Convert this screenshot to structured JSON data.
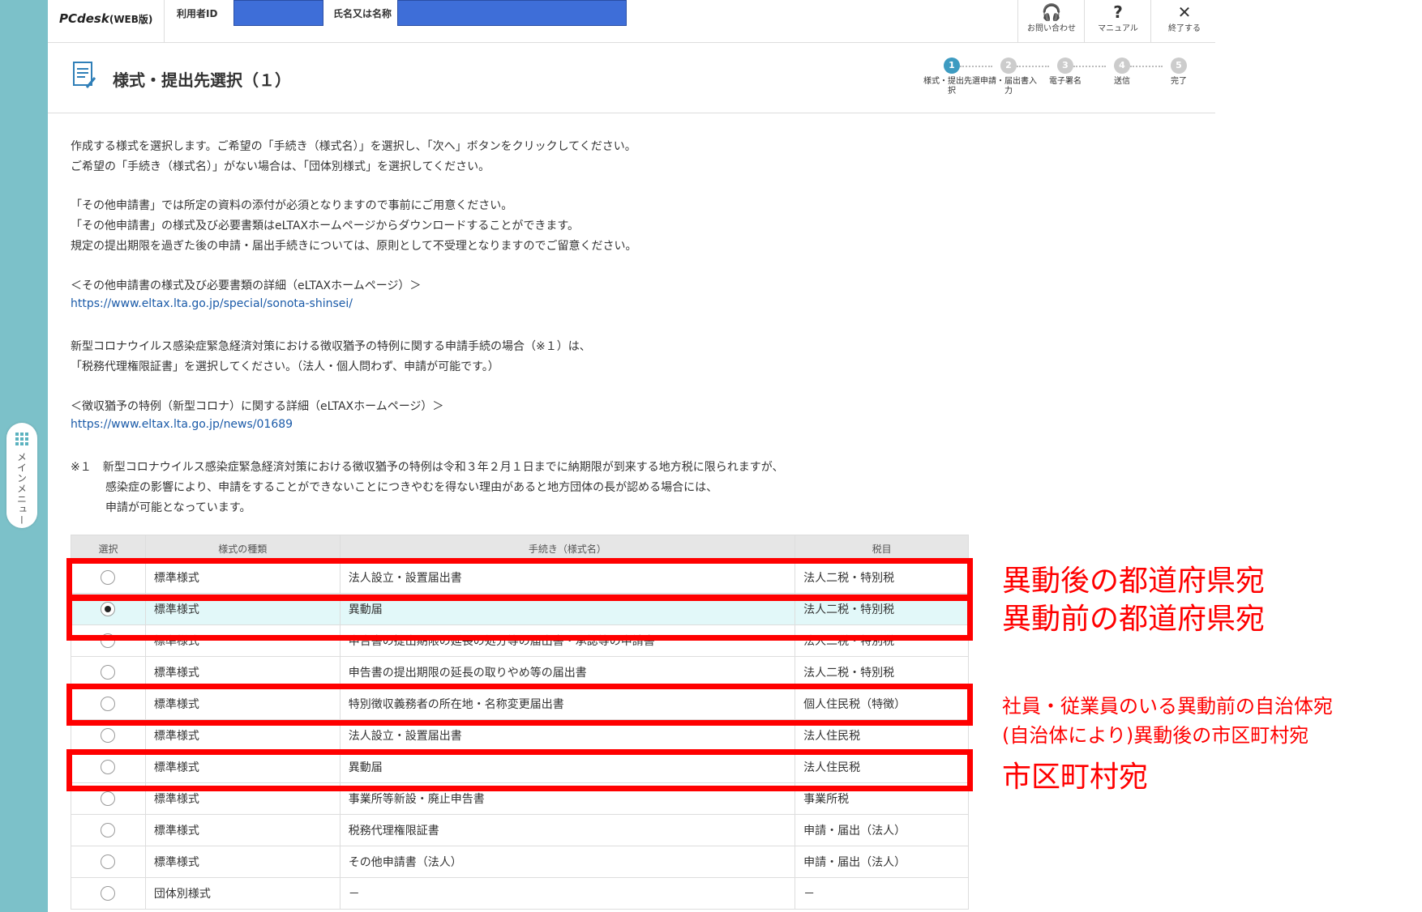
{
  "header": {
    "logo_main": "PCdesk",
    "logo_sub": "(WEB版)",
    "user_id_label": "利用者ID",
    "name_label": "氏名又は名称",
    "buttons": [
      {
        "icon": "headset-icon",
        "glyph": "🎧",
        "label": "お問い合わせ"
      },
      {
        "icon": "help-icon",
        "glyph": "?",
        "label": "マニュアル"
      },
      {
        "icon": "close-icon",
        "glyph": "✕",
        "label": "終了する"
      }
    ]
  },
  "side_menu": {
    "label": "メインメニュー"
  },
  "title": "様式・提出先選択（１）",
  "steps": [
    {
      "num": "1",
      "label": "様式・提出先選択",
      "active": true
    },
    {
      "num": "2",
      "label": "申請・届出書入力",
      "active": false
    },
    {
      "num": "3",
      "label": "電子署名",
      "active": false
    },
    {
      "num": "4",
      "label": "送信",
      "active": false
    },
    {
      "num": "5",
      "label": "完了",
      "active": false
    }
  ],
  "instructions": [
    "作成する様式を選択します。ご希望の「手続き（様式名）」を選択し、「次へ」ボタンをクリックしてください。",
    "ご希望の「手続き（様式名）」がない場合は、「団体別様式」を選択してください。",
    "「その他申請書」では所定の資料の添付が必須となりますので事前にご用意ください。",
    "「その他申請書」の様式及び必要書類はeLTAXホームページからダウンロードすることができます。",
    "規定の提出期限を過ぎた後の申請・届出手続きについては、原則として不受理となりますのでご留意ください。",
    "＜その他申請書の様式及び必要書類の詳細（eLTAXホームページ）＞",
    "https://www.eltax.lta.go.jp/special/sonota-shinsei/",
    "新型コロナウイルス感染症緊急経済対策における徴収猶予の特例に関する申請手続の場合（※１）は、",
    "「税務代理権限証書」を選択してください。（法人・個人問わず、申請が可能です。）",
    "＜徴収猶予の特例（新型コロナ）に関する詳細（eLTAXホームページ）＞",
    "https://www.eltax.lta.go.jp/news/01689",
    "※１　新型コロナウイルス感染症緊急経済対策における徴収猶予の特例は令和３年２月１日までに納期限が到来する地方税に限られますが、",
    "感染症の影響により、申請をすることができないことにつきやむを得ない理由があると地方団体の長が認める場合には、",
    "申請が可能となっています。"
  ],
  "table": {
    "headers": [
      "選択",
      "様式の種類",
      "手続き（様式名）",
      "税目"
    ],
    "rows": [
      {
        "type": "標準様式",
        "name": "法人設立・設置届出書",
        "tax": "法人二税・特別税",
        "selected": false
      },
      {
        "type": "標準様式",
        "name": "異動届",
        "tax": "法人二税・特別税",
        "selected": true
      },
      {
        "type": "標準様式",
        "name": "申告書の提出期限の延長の処分等の届出書・承認等の申請書",
        "tax": "法人二税・特別税",
        "selected": false
      },
      {
        "type": "標準様式",
        "name": "申告書の提出期限の延長の取りやめ等の届出書",
        "tax": "法人二税・特別税",
        "selected": false
      },
      {
        "type": "標準様式",
        "name": "特別徴収義務者の所在地・名称変更届出書",
        "tax": "個人住民税（特徴）",
        "selected": false
      },
      {
        "type": "標準様式",
        "name": "法人設立・設置届出書",
        "tax": "法人住民税",
        "selected": false
      },
      {
        "type": "標準様式",
        "name": "異動届",
        "tax": "法人住民税",
        "selected": false
      },
      {
        "type": "標準様式",
        "name": "事業所等新設・廃止申告書",
        "tax": "事業所税",
        "selected": false
      },
      {
        "type": "標準様式",
        "name": "税務代理権限証書",
        "tax": "申請・届出（法人）",
        "selected": false
      },
      {
        "type": "標準様式",
        "name": "その他申請書（法人）",
        "tax": "申請・届出（法人）",
        "selected": false
      },
      {
        "type": "団体別様式",
        "name": "－",
        "tax": "－",
        "selected": false
      }
    ]
  },
  "annotations": {
    "a1": "異動後の都道府県宛",
    "a2": "異動前の都道府県宛",
    "a3": "社員・従業員のいる異動前の自治体宛",
    "a4": "(自治体により)異動後の市区町村宛",
    "a5": "市区町村宛",
    "color": "#ff0000"
  }
}
